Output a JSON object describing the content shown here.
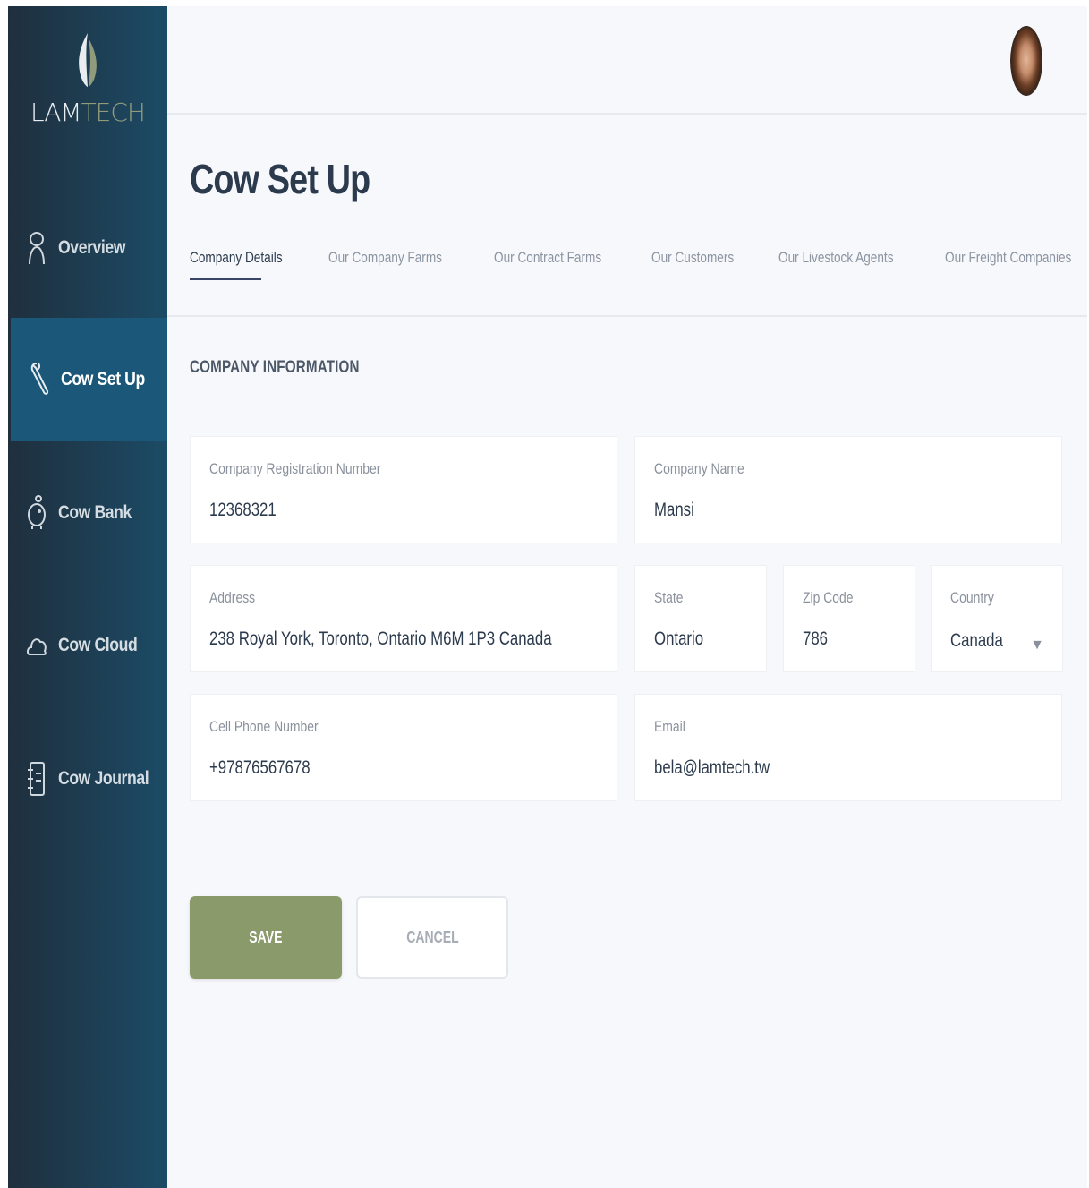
{
  "app": {
    "logo_part1": "LAM",
    "logo_part2": "TECH",
    "colors": {
      "sidebar_dark": "#1f2f3d",
      "sidebar_active": "#1a5778",
      "accent_green": "#8a9a6a",
      "logo_gray": "#8f9b7a"
    }
  },
  "sidebar": {
    "items": [
      {
        "label": "Overview",
        "icon": "person-icon",
        "active": false
      },
      {
        "label": "Cow Set Up",
        "icon": "wrench-icon",
        "active": true
      },
      {
        "label": "Cow Bank",
        "icon": "piggy-bank-icon",
        "active": false
      },
      {
        "label": "Cow Cloud",
        "icon": "cloud-icon",
        "active": false
      },
      {
        "label": "Cow Journal",
        "icon": "journal-icon",
        "active": false
      }
    ]
  },
  "header": {
    "avatar": "user-avatar"
  },
  "page": {
    "title": "Cow Set Up",
    "tabs": [
      {
        "label": "Company Details",
        "active": true
      },
      {
        "label": "Our Company Farms",
        "active": false
      },
      {
        "label": "Our Contract Farms",
        "active": false
      },
      {
        "label": "Our Customers",
        "active": false
      },
      {
        "label": "Our Livestock Agents",
        "active": false
      },
      {
        "label": "Our Freight Companies",
        "active": false
      }
    ],
    "section_title": "COMPANY INFORMATION"
  },
  "form": {
    "registration": {
      "label": "Company Registration Number",
      "value": "12368321"
    },
    "company_name": {
      "label": "Company Name",
      "value": "Mansi"
    },
    "address": {
      "label": "Address",
      "value": "238 Royal York, Toronto, Ontario M6M 1P3 Canada"
    },
    "state": {
      "label": "State",
      "value": "Ontario"
    },
    "zip": {
      "label": "Zip Code",
      "value": "786"
    },
    "country": {
      "label": "Country",
      "value": "Canada",
      "caret": "▼"
    },
    "phone": {
      "label": "Cell Phone Number",
      "value": "+97876567678"
    },
    "email": {
      "label": "Email",
      "value": "bela@lamtech.tw"
    }
  },
  "actions": {
    "save_label": "SAVE",
    "cancel_label": "CANCEL"
  }
}
